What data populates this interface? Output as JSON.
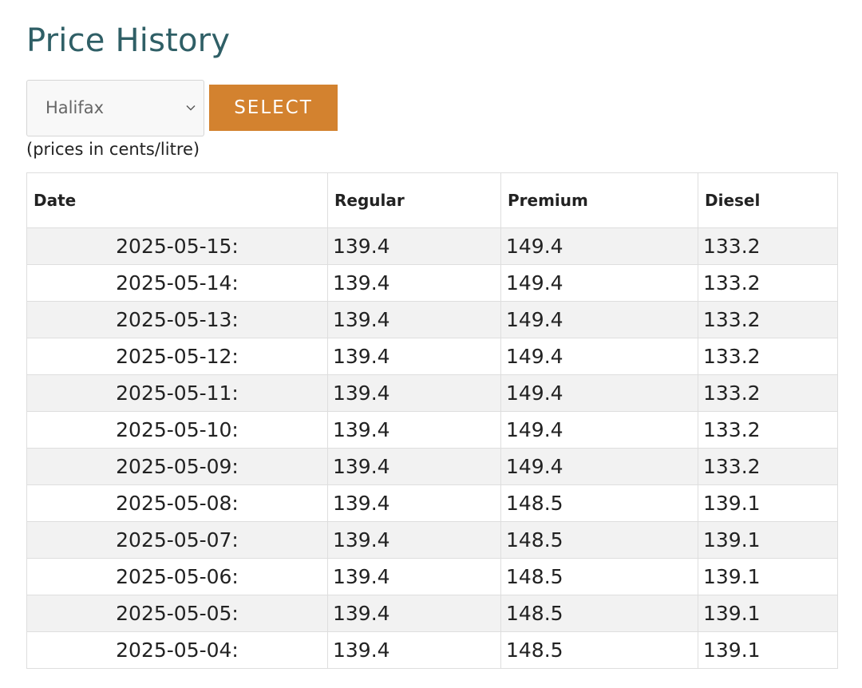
{
  "page": {
    "title": "Price History",
    "units_note": "(prices in cents/litre)"
  },
  "controls": {
    "selected_city": "Halifax",
    "select_button_label": "SELECT"
  },
  "table": {
    "headers": {
      "date": "Date",
      "regular": "Regular",
      "premium": "Premium",
      "diesel": "Diesel"
    },
    "rows": [
      {
        "date": "2025-05-15:",
        "regular": "139.4",
        "premium": "149.4",
        "diesel": "133.2"
      },
      {
        "date": "2025-05-14:",
        "regular": "139.4",
        "premium": "149.4",
        "diesel": "133.2"
      },
      {
        "date": "2025-05-13:",
        "regular": "139.4",
        "premium": "149.4",
        "diesel": "133.2"
      },
      {
        "date": "2025-05-12:",
        "regular": "139.4",
        "premium": "149.4",
        "diesel": "133.2"
      },
      {
        "date": "2025-05-11:",
        "regular": "139.4",
        "premium": "149.4",
        "diesel": "133.2"
      },
      {
        "date": "2025-05-10:",
        "regular": "139.4",
        "premium": "149.4",
        "diesel": "133.2"
      },
      {
        "date": "2025-05-09:",
        "regular": "139.4",
        "premium": "149.4",
        "diesel": "133.2"
      },
      {
        "date": "2025-05-08:",
        "regular": "139.4",
        "premium": "148.5",
        "diesel": "139.1"
      },
      {
        "date": "2025-05-07:",
        "regular": "139.4",
        "premium": "148.5",
        "diesel": "139.1"
      },
      {
        "date": "2025-05-06:",
        "regular": "139.4",
        "premium": "148.5",
        "diesel": "139.1"
      },
      {
        "date": "2025-05-05:",
        "regular": "139.4",
        "premium": "148.5",
        "diesel": "139.1"
      },
      {
        "date": "2025-05-04:",
        "regular": "139.4",
        "premium": "148.5",
        "diesel": "139.1"
      }
    ]
  },
  "colors": {
    "title": "#2f5f66",
    "button": "#d3822f",
    "stripe": "#f2f2f2",
    "border": "#dedede"
  },
  "icons": {
    "dropdown": "chevron-down-icon"
  }
}
